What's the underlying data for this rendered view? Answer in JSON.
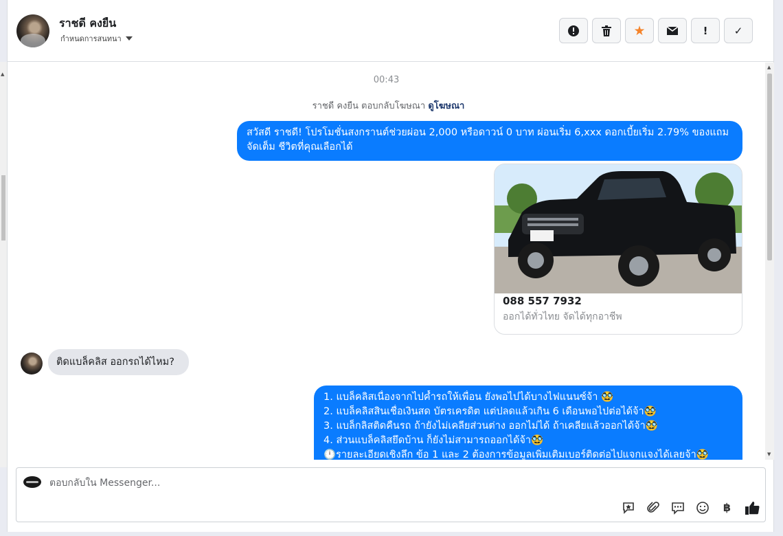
{
  "header": {
    "contact_name": "ราชดี คงยืน",
    "conversation_label": "กำหนดการสนทนา"
  },
  "toolbar": {
    "spam": "!",
    "delete": "🗑",
    "star": "★",
    "mail": "✉",
    "important": "!",
    "done": "✓"
  },
  "chat": {
    "timestamp": "00:43",
    "ad_reply_prefix": "ราชดี คงยืน ตอบกลับโฆษณา",
    "ad_reply_link": "ดูโฆษณา",
    "outgoing_1_lines": [
      "สวัสดี ราชดี! โปรโมชั่นสงกรานต์ช่วยผ่อน 2,000 หรือดาวน์ 0 บาท ผ่อนเริ่ม 6,xxx ดอกเบี้ยเริ่ม 2.79% ของแถม",
      "จัดเต็ม ชีวิตที่คุณเลือกได้"
    ],
    "ad_card": {
      "phone": "088 557 7932",
      "description": "ออกได้ทั่วไทย จัดได้ทุกอาชีพ"
    },
    "incoming_1": "ติดแบล็คลิส ออกรถได้ไหม?",
    "outgoing_2_lines": [
      "1. แบล็คลิสเนื่องจากไปค้ำรถให้เพื่อน ยังพอไปได้บางไฟแนนซ์จ้า 🥸",
      "2. แบล็คลิสสินเชื่อเงินสด บัตรเครดิต แต่ปลดแล้วเกิน 6 เดือนพอไปต่อได้จ้า🥸",
      "3. แบล็กลิสติดคืนรถ ถ้ายังไม่เคลียส่วนต่าง ออกไม่ได้ ถ้าเคลียแล้วออกได้จ้า🥸",
      "4. ส่วนแบล็คลิสยึดบ้าน ก็ยังไม่สามารถออกได้จ้า🥸",
      "🕛รายละเอียดเชิงลึก ข้อ 1 และ 2 ต้องการข้อมูลเพิ่มเติมเบอร์ติดต่อไปแจกแจงได้เลยจ้า🥸"
    ]
  },
  "composer": {
    "placeholder": "ตอบกลับใน Messenger..."
  },
  "colors": {
    "accent": "#0a7cff",
    "incoming_bubble": "#e4e6eb",
    "star": "#f5842b"
  }
}
